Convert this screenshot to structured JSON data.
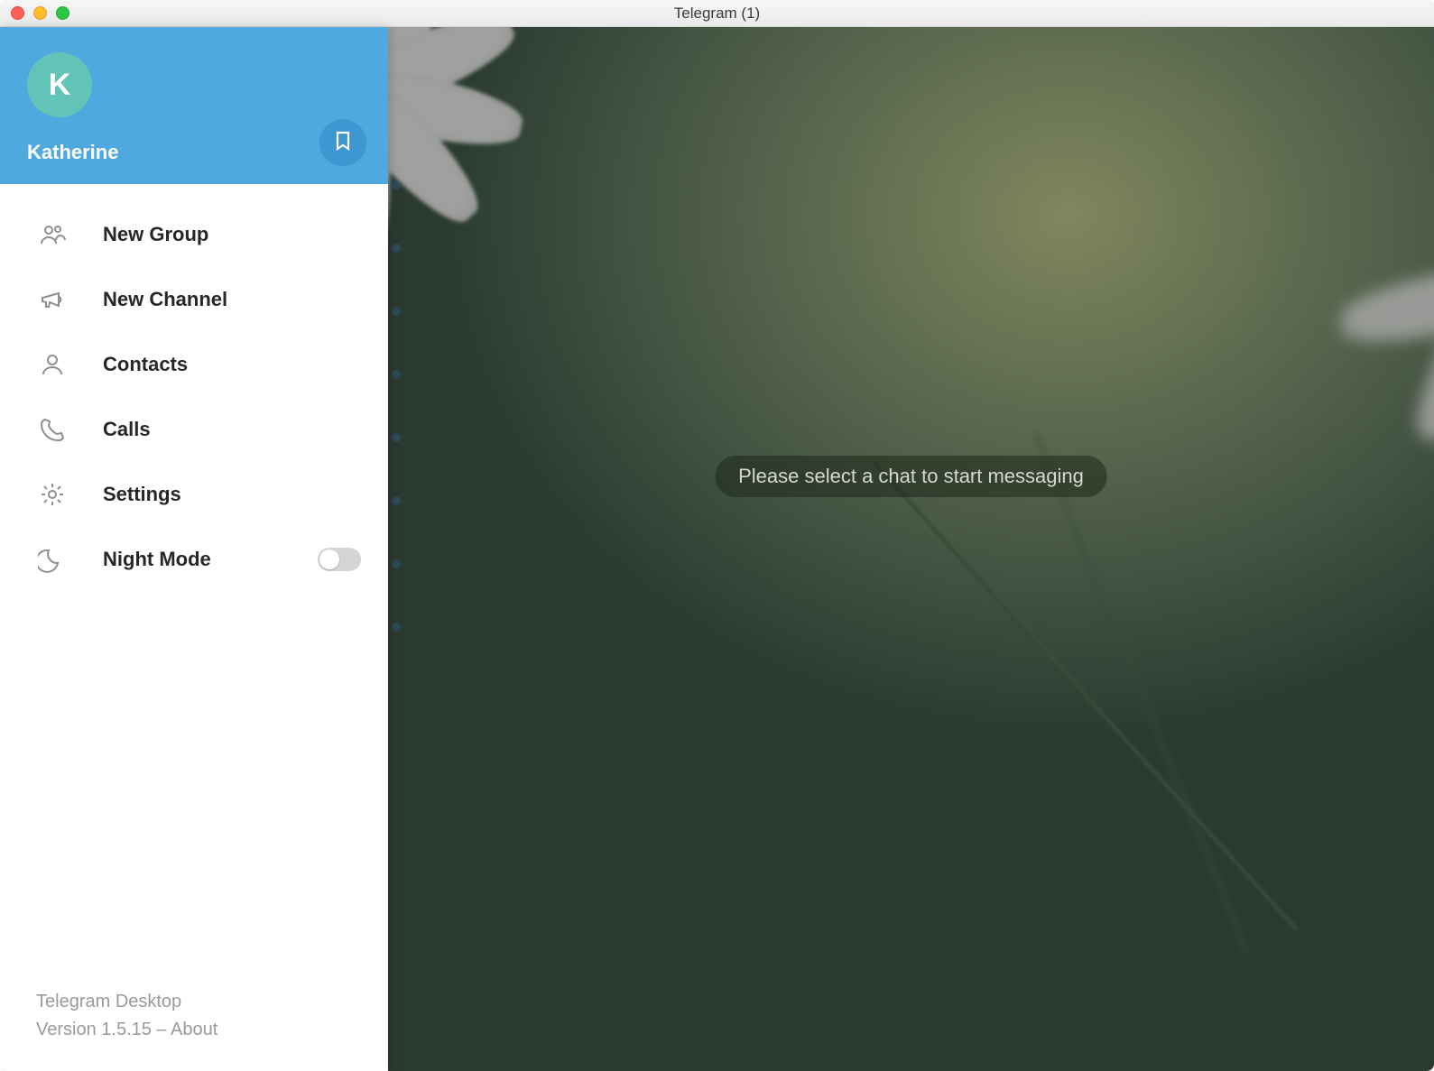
{
  "window": {
    "title": "Telegram (1)"
  },
  "profile": {
    "initial": "K",
    "name": "Katherine"
  },
  "menu": {
    "items": [
      {
        "label": "New Group"
      },
      {
        "label": "New Channel"
      },
      {
        "label": "Contacts"
      },
      {
        "label": "Calls"
      },
      {
        "label": "Settings"
      },
      {
        "label": "Night Mode"
      }
    ]
  },
  "footer": {
    "app_name": "Telegram Desktop",
    "version_line": "Version 1.5.15 – ",
    "about": "About"
  },
  "main": {
    "placeholder": "Please select a chat to start messaging"
  }
}
